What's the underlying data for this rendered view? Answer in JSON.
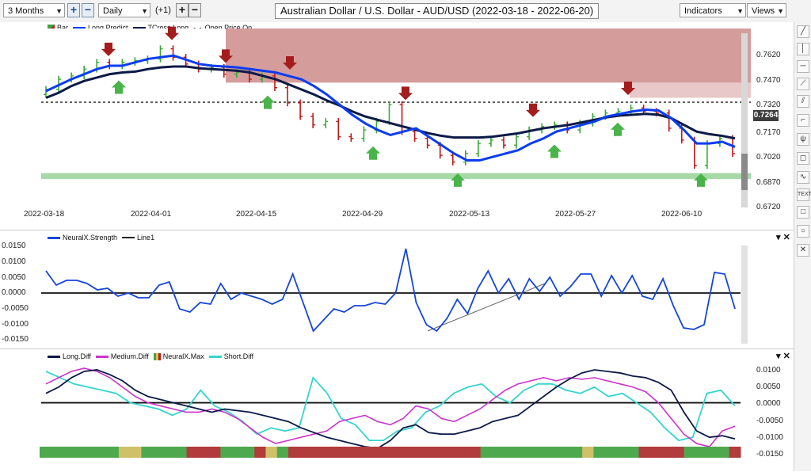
{
  "toolbar": {
    "period": "3 Months",
    "interval": "Daily",
    "offset": "(+1)",
    "plus": "+",
    "minus": "−",
    "title": "Australian Dollar / U.S. Dollar - AUD/USD (2022-03-18 - 2022-06-20)",
    "indicators": "Indicators",
    "views": "Views"
  },
  "price_panel": {
    "legend": {
      "bar": "Bar",
      "long_predict": "Long.Predict",
      "tcross_long": "TCross.Long",
      "open_price": "Open Price On"
    },
    "y_ticks": [
      "0.7620",
      "0.7470",
      "0.7320",
      "0.7170",
      "0.7020",
      "0.6870",
      "0.6720"
    ],
    "price_marker": "0.7264",
    "x_ticks": [
      "2022-03-18",
      "2022-04-01",
      "2022-04-15",
      "2022-04-29",
      "2022-05-13",
      "2022-05-27",
      "2022-06-10"
    ]
  },
  "strength_panel": {
    "legend": {
      "strength": "NeuralX.Strength",
      "line1": "Line1"
    },
    "y_ticks": [
      "0.0150",
      "0.0100",
      "0.0050",
      "0.0000",
      "-0.0050",
      "-0.0100",
      "-0.0150"
    ]
  },
  "diff_panel": {
    "legend": {
      "long": "Long.Diff",
      "medium": "Medium.Diff",
      "max": "NeuralX.Max",
      "short": "Short.Diff"
    },
    "y_ticks": [
      "0.0100",
      "0.0050",
      "0.0000",
      "-0.0050",
      "-0.0100",
      "-0.0150"
    ]
  },
  "colors": {
    "up_bar": "#3aa83a",
    "down_bar": "#c01818",
    "long_predict": "#0a3df0",
    "tcross_long": "#0b1a46",
    "strength": "#1546d8",
    "medium": "#cc33cc",
    "short": "#33d6cc",
    "resistance": "#b24a4a",
    "support": "#3caa3c"
  },
  "chart_data": [
    {
      "type": "ohlc-bar",
      "title": "Australian Dollar / U.S. Dollar - AUD/USD (2022-03-18 - 2022-06-20)",
      "x_start": "2022-03-18",
      "x_end": "2022-06-20",
      "ylim": [
        0.666,
        0.77
      ],
      "open_price_line": 0.7264,
      "resistance_zone": [
        0.738,
        0.77
      ],
      "support_zone": [
        0.681,
        0.6845
      ],
      "series": [
        {
          "name": "Long.Predict",
          "values": [
            0.733,
            0.7365,
            0.74,
            0.743,
            0.746,
            0.748,
            0.748,
            0.75,
            0.752,
            0.753,
            0.754,
            0.7515,
            0.749,
            0.748,
            0.7475,
            0.747,
            0.746,
            0.745,
            0.744,
            0.742,
            0.74,
            0.736,
            0.731,
            0.725,
            0.719,
            0.714,
            0.71,
            0.707,
            0.709,
            0.711,
            0.706,
            0.701,
            0.696,
            0.692,
            0.692,
            0.694,
            0.696,
            0.698,
            0.702,
            0.705,
            0.709,
            0.711,
            0.713,
            0.715,
            0.718,
            0.7195,
            0.721,
            0.722,
            0.7215,
            0.717,
            0.71,
            0.702,
            0.702,
            0.703,
            0.7
          ]
        },
        {
          "name": "TCross.Long",
          "values": [
            0.729,
            0.732,
            0.736,
            0.739,
            0.741,
            0.743,
            0.744,
            0.7445,
            0.746,
            0.747,
            0.7475,
            0.7475,
            0.7465,
            0.746,
            0.7455,
            0.745,
            0.744,
            0.742,
            0.74,
            0.737,
            0.734,
            0.731,
            0.7275,
            0.7245,
            0.721,
            0.718,
            0.716,
            0.714,
            0.712,
            0.71,
            0.708,
            0.7065,
            0.7055,
            0.7055,
            0.7055,
            0.706,
            0.707,
            0.708,
            0.7095,
            0.711,
            0.712,
            0.713,
            0.7145,
            0.716,
            0.7175,
            0.7185,
            0.719,
            0.7195,
            0.719,
            0.717,
            0.713,
            0.709,
            0.7075,
            0.7065,
            0.705
          ]
        },
        {
          "name": "Bar",
          "close": [
            0.734,
            0.74,
            0.742,
            0.746,
            0.75,
            0.748,
            0.75,
            0.751,
            0.752,
            0.758,
            0.753,
            0.749,
            0.746,
            0.747,
            0.743,
            0.744,
            0.74,
            0.742,
            0.735,
            0.726,
            0.718,
            0.713,
            0.715,
            0.706,
            0.705,
            0.71,
            0.715,
            0.725,
            0.709,
            0.705,
            0.701,
            0.695,
            0.691,
            0.696,
            0.702,
            0.704,
            0.701,
            0.706,
            0.71,
            0.712,
            0.713,
            0.71,
            0.714,
            0.718,
            0.72,
            0.721,
            0.723,
            0.721,
            0.72,
            0.711,
            0.704,
            0.689,
            0.702,
            0.705,
            0.696
          ]
        }
      ]
    },
    {
      "type": "line",
      "ylim": [
        -0.015,
        0.015
      ],
      "series": [
        {
          "name": "NeuralX.Strength",
          "values": [
            0.007,
            0.0025,
            0.004,
            0.004,
            0.003,
            0.001,
            0.0015,
            -0.001,
            0.0,
            -0.0015,
            -0.0015,
            0.0025,
            0.0035,
            -0.005,
            -0.006,
            -0.003,
            -0.0035,
            0.003,
            -0.002,
            0.0,
            -0.001,
            -0.002,
            -0.0035,
            -0.002,
            0.006,
            -0.003,
            -0.012,
            -0.0085,
            -0.005,
            -0.006,
            -0.004,
            -0.004,
            -0.003,
            -0.0035,
            0.0,
            0.014,
            -0.003,
            -0.01,
            -0.012,
            -0.008,
            -0.002,
            -0.0065,
            0.0015,
            0.007,
            0.0,
            0.0045,
            -0.002,
            0.0045,
            0.0005,
            0.005,
            -0.001,
            0.002,
            0.006,
            0.006,
            -0.001,
            0.0055,
            0.0,
            0.0055,
            -0.001,
            -0.002,
            0.0045,
            -0.004,
            -0.011,
            -0.0115,
            -0.01,
            0.0065,
            0.006,
            -0.005
          ]
        },
        {
          "name": "Line1",
          "values": [
            0.0,
            0.0
          ]
        }
      ]
    },
    {
      "type": "line",
      "ylim": [
        -0.015,
        0.011
      ],
      "series": [
        {
          "name": "Long.Diff",
          "values": [
            0.003,
            0.005,
            0.008,
            0.01,
            0.0105,
            0.009,
            0.007,
            0.004,
            0.002,
            0.001,
            0.0,
            -0.001,
            -0.002,
            -0.003,
            -0.002,
            -0.0025,
            -0.003,
            -0.004,
            -0.005,
            -0.006,
            -0.008,
            -0.0095,
            -0.011,
            -0.012,
            -0.013,
            -0.014,
            -0.0145,
            -0.012,
            -0.008,
            -0.007,
            -0.0095,
            -0.01,
            -0.01,
            -0.009,
            -0.008,
            -0.006,
            -0.005,
            -0.004,
            -0.001,
            0.002,
            0.005,
            0.0075,
            0.0095,
            0.0105,
            0.01,
            0.0095,
            0.0085,
            0.008,
            0.0065,
            0.004,
            -0.003,
            -0.009,
            -0.011,
            -0.0105,
            -0.0115
          ]
        },
        {
          "name": "Medium.Diff",
          "values": [
            0.006,
            0.008,
            0.01,
            0.011,
            0.01,
            0.008,
            0.005,
            0.002,
            0.0,
            -0.001,
            -0.002,
            -0.003,
            -0.003,
            -0.002,
            -0.003,
            -0.005,
            -0.008,
            -0.011,
            -0.013,
            -0.012,
            -0.011,
            -0.01,
            -0.009,
            -0.006,
            -0.005,
            -0.004,
            -0.006,
            -0.007,
            -0.005,
            -0.001,
            -0.002,
            -0.005,
            -0.006,
            -0.004,
            -0.002,
            0.001,
            0.004,
            0.006,
            0.007,
            0.008,
            0.007,
            0.008,
            0.0075,
            0.008,
            0.007,
            0.006,
            0.005,
            0.0035,
            0.0,
            -0.005,
            -0.01,
            -0.013,
            -0.014,
            -0.009,
            -0.0075
          ]
        },
        {
          "name": "Short.Diff",
          "values": [
            0.01,
            0.008,
            0.006,
            0.005,
            0.004,
            0.003,
            0.0,
            -0.001,
            -0.002,
            -0.004,
            -0.002,
            0.004,
            -0.001,
            -0.003,
            -0.006,
            -0.01,
            -0.008,
            -0.009,
            -0.008,
            0.008,
            0.003,
            -0.005,
            -0.007,
            -0.012,
            -0.012,
            -0.009,
            -0.008,
            -0.003,
            -0.001,
            0.003,
            0.005,
            0.006,
            0.002,
            0.0,
            0.004,
            0.006,
            0.006,
            0.004,
            0.003,
            0.005,
            0.002,
            0.003,
            0.0,
            -0.003,
            -0.008,
            -0.012,
            -0.011,
            0.003,
            0.004,
            -0.001
          ]
        },
        {
          "name": "NeuralX.Max",
          "values": [
            1,
            1,
            1,
            1,
            1,
            1,
            1,
            0,
            0,
            1,
            1,
            1,
            1,
            -1,
            -1,
            -1,
            1,
            1,
            1,
            -1,
            0,
            1,
            -1,
            -1,
            -1,
            -1,
            -1,
            -1,
            -1,
            -1,
            -1,
            -1,
            -1,
            -1,
            -1,
            -1,
            -1,
            -1,
            -1,
            1,
            1,
            1,
            1,
            1,
            1,
            1,
            1,
            1,
            0,
            1,
            1,
            1,
            1,
            -1,
            -1,
            -1,
            -1,
            1,
            1,
            1,
            1,
            -1
          ]
        }
      ]
    }
  ]
}
